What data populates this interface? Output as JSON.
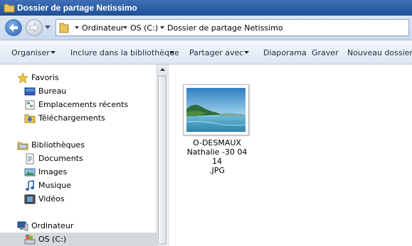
{
  "window": {
    "title": "Dossier de partage Netissimo"
  },
  "address": {
    "crumbs": [
      "Ordinateur",
      "OS (C:)",
      "Dossier de partage Netissimo"
    ]
  },
  "toolbar": {
    "organize": "Organiser",
    "include_library": "Inclure dans la bibliothèque",
    "share_with": "Partager avec",
    "slideshow": "Diaporama",
    "burn": "Graver",
    "new_folder": "Nouveau dossier"
  },
  "nav": {
    "favorites": {
      "header": "Favoris",
      "items": [
        "Bureau",
        "Emplacements récents",
        "Téléchargements"
      ]
    },
    "libraries": {
      "header": "Bibliothèques",
      "items": [
        "Documents",
        "Images",
        "Musique",
        "Vidéos"
      ]
    },
    "computer": {
      "header": "Ordinateur",
      "items": [
        "OS (C:)"
      ],
      "selected": "OS (C:)"
    }
  },
  "files": [
    {
      "name_lines": [
        "O-DESMAUX",
        "Nathalie -30 04 14",
        ".JPG"
      ],
      "icon": "image-thumbnail"
    }
  ],
  "colors": {
    "title_bar": "#2a5aa0",
    "selection": "#d5d9de"
  }
}
